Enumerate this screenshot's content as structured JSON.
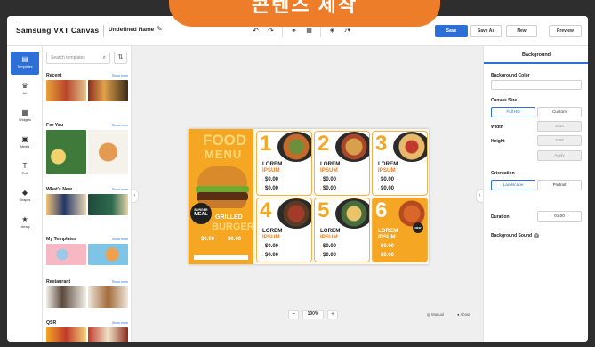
{
  "banner": {
    "text": "콘텐츠 제작"
  },
  "header": {
    "brand": "Samsung VXT Canvas",
    "doc_name": "Undefined Name",
    "buttons": {
      "save": "Save",
      "save_as": "Save As",
      "new": "New",
      "preview": "Preview"
    }
  },
  "rail": {
    "items": [
      {
        "label": "Templates",
        "icon": "templates-icon"
      },
      {
        "label": "Art",
        "icon": "art-icon"
      },
      {
        "label": "Widgets",
        "icon": "widgets-icon"
      },
      {
        "label": "Media",
        "icon": "media-icon"
      },
      {
        "label": "Text",
        "icon": "text-icon"
      },
      {
        "label": "Shapes",
        "icon": "shapes-icon"
      },
      {
        "label": "Library",
        "icon": "library-icon"
      }
    ]
  },
  "templates": {
    "search_placeholder": "Search templates",
    "show_more": "Show more",
    "sections": [
      "Recent",
      "For You",
      "What's New",
      "My Templates",
      "Restaurant",
      "QSR"
    ]
  },
  "poster": {
    "hero": {
      "food": "FOOD",
      "menu": "MENU",
      "meal_top": "BURGER",
      "meal": "MEAL",
      "grilled": "GRILLED",
      "burger": "BURGER",
      "price": "$0.00"
    },
    "cards": [
      {
        "num": "1",
        "line1": "LOREM",
        "line2": "IPSUM",
        "price": "$0.00"
      },
      {
        "num": "2",
        "line1": "LOREM",
        "line2": "IPSUM",
        "price": "$0.00"
      },
      {
        "num": "3",
        "line1": "LOREM",
        "line2": "IPSUM",
        "price": "$0.00"
      },
      {
        "num": "4",
        "line1": "LOREM",
        "line2": "IPSUM",
        "price": "$0.00"
      },
      {
        "num": "5",
        "line1": "LOREM",
        "line2": "IPSUM",
        "price": "$0.00"
      },
      {
        "num": "6",
        "line1": "LOREM",
        "line2": "IPSUM",
        "price": "$0.00"
      }
    ],
    "new_badge": "NEW"
  },
  "footer": {
    "zoom": "100%",
    "manual": "Manual",
    "about": "About"
  },
  "right_panel": {
    "title": "Background",
    "bg_color_label": "Background Color",
    "canvas_size_label": "Canvas Size",
    "full_hd": "Full HD",
    "custom": "Custom",
    "width_label": "Width",
    "width_value": "1920",
    "height_label": "Height",
    "height_value": "1080",
    "apply": "Apply",
    "orientation_label": "Orientation",
    "landscape": "Landscape",
    "portrait": "Portrait",
    "duration_label": "Duration",
    "duration_value": "01:00",
    "bg_sound_label": "Background Sound"
  },
  "colors": {
    "accent": "#2d6fd6",
    "orange": "#f5a623",
    "banner": "#ee7d2a"
  }
}
